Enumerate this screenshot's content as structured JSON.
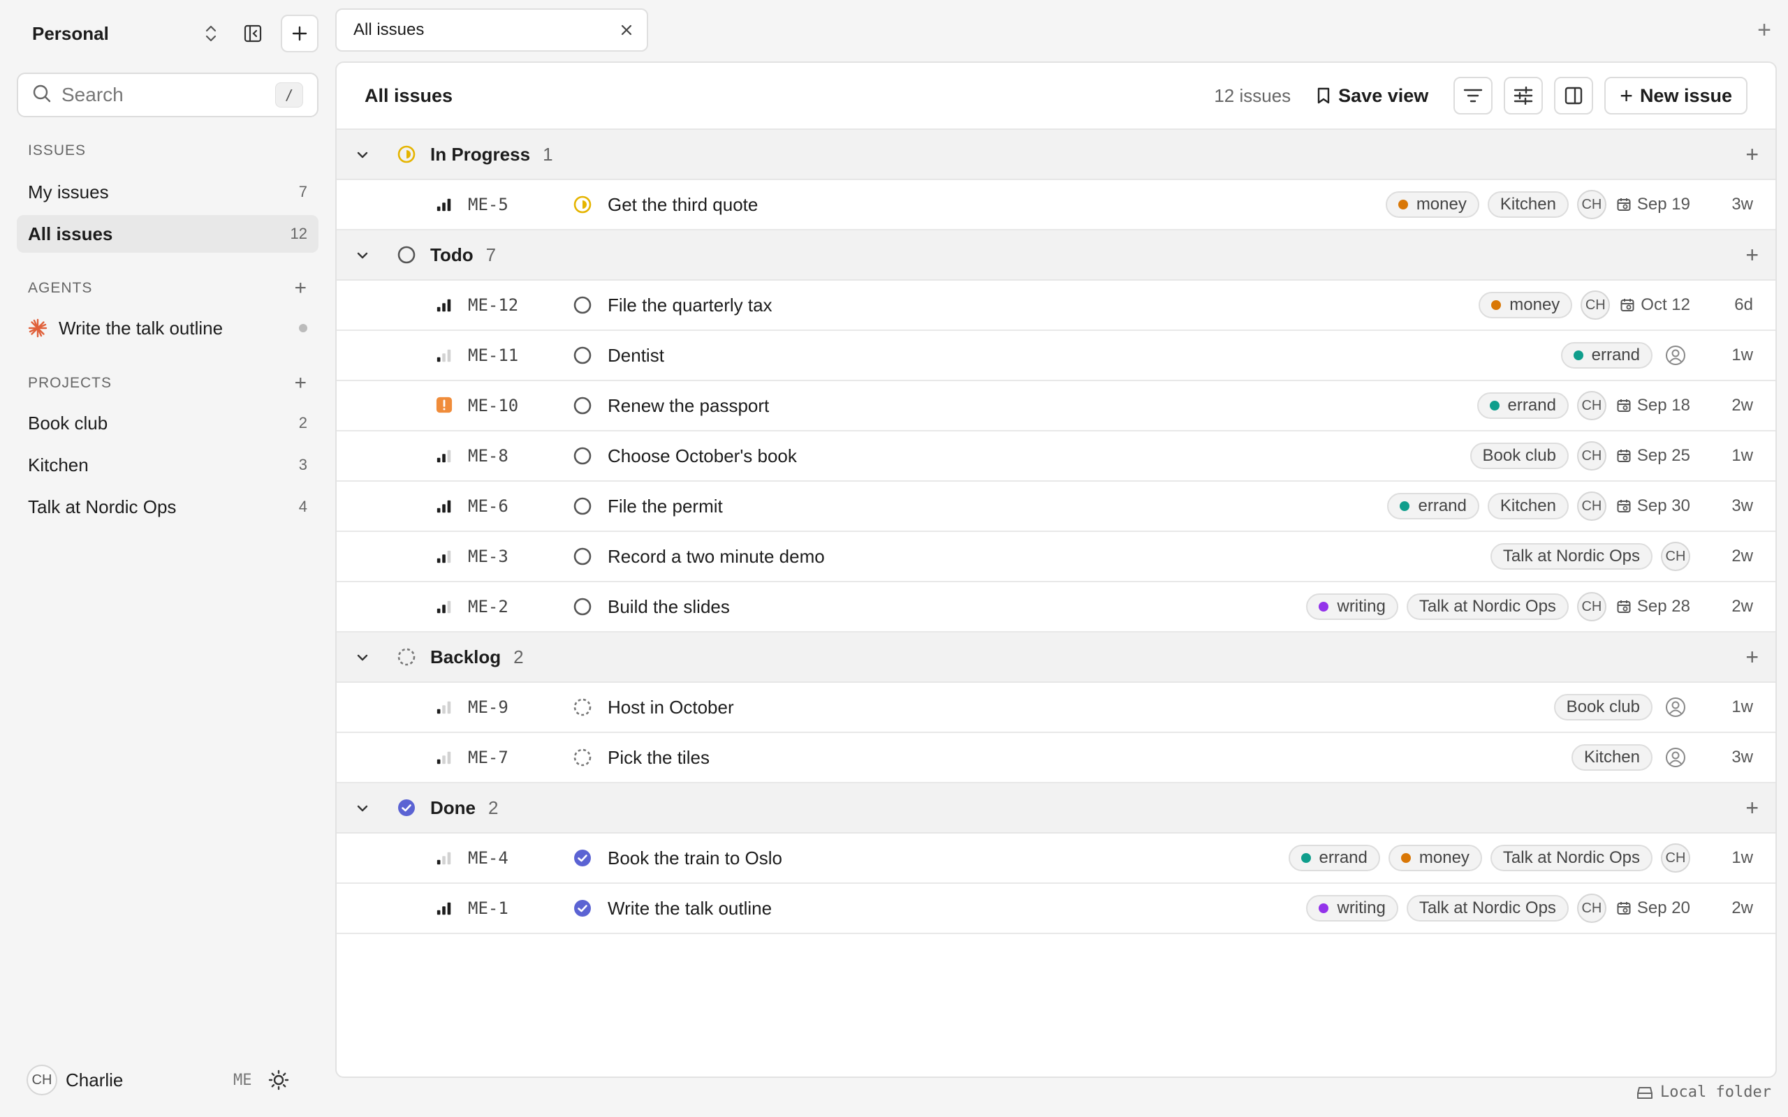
{
  "sidebar": {
    "workspace": "Personal",
    "search": {
      "placeholder": "Search",
      "shortcut": "/"
    },
    "issues_heading": "ISSUES",
    "my_issues": {
      "label": "My issues",
      "count": "7"
    },
    "all_issues": {
      "label": "All issues",
      "count": "12"
    },
    "agents_heading": "AGENTS",
    "agent": {
      "label": "Write the talk outline"
    },
    "projects_heading": "PROJECTS",
    "projects": [
      {
        "label": "Book club",
        "count": "2"
      },
      {
        "label": "Kitchen",
        "count": "3"
      },
      {
        "label": "Talk at Nordic Ops",
        "count": "4"
      }
    ],
    "user": {
      "initials": "CH",
      "name": "Charlie",
      "tag": "ME"
    }
  },
  "tab": {
    "label": "All issues"
  },
  "header": {
    "title": "All issues",
    "count": "12 issues",
    "save_view": "Save view",
    "new_issue": "New issue"
  },
  "footer": {
    "label": "Local folder"
  },
  "colors": {
    "money": "#d97706",
    "errand": "#0f9e8c",
    "writing": "#9333ea",
    "in_progress": "#e5b400",
    "done": "#5b63d3",
    "urgent": "#f08c3a"
  },
  "groups": [
    {
      "name": "In Progress",
      "count": "1",
      "status": "in-progress",
      "rows": [
        {
          "id": "ME-5",
          "title": "Get the third quote",
          "prio": "high",
          "status": "in-progress",
          "chips": [
            {
              "label": "money",
              "dot": "money"
            },
            {
              "label": "Kitchen"
            }
          ],
          "assignee": "CH",
          "due": "Sep 19",
          "age": "3w"
        }
      ]
    },
    {
      "name": "Todo",
      "count": "7",
      "status": "todo",
      "rows": [
        {
          "id": "ME-12",
          "title": "File the quarterly tax",
          "prio": "high",
          "status": "todo",
          "chips": [
            {
              "label": "money",
              "dot": "money"
            }
          ],
          "assignee": "CH",
          "due": "Oct 12",
          "age": "6d"
        },
        {
          "id": "ME-11",
          "title": "Dentist",
          "prio": "low",
          "status": "todo",
          "chips": [
            {
              "label": "errand",
              "dot": "errand"
            }
          ],
          "assignee": "",
          "due": "",
          "age": "1w"
        },
        {
          "id": "ME-10",
          "title": "Renew the passport",
          "prio": "urgent",
          "status": "todo",
          "chips": [
            {
              "label": "errand",
              "dot": "errand"
            }
          ],
          "assignee": "CH",
          "due": "Sep 18",
          "age": "2w"
        },
        {
          "id": "ME-8",
          "title": "Choose October's book",
          "prio": "medium",
          "status": "todo",
          "chips": [
            {
              "label": "Book club"
            }
          ],
          "assignee": "CH",
          "due": "Sep 25",
          "age": "1w"
        },
        {
          "id": "ME-6",
          "title": "File the permit",
          "prio": "high",
          "status": "todo",
          "chips": [
            {
              "label": "errand",
              "dot": "errand"
            },
            {
              "label": "Kitchen"
            }
          ],
          "assignee": "CH",
          "due": "Sep 30",
          "age": "3w"
        },
        {
          "id": "ME-3",
          "title": "Record a two minute demo",
          "prio": "medium",
          "status": "todo",
          "chips": [
            {
              "label": "Talk at Nordic Ops"
            }
          ],
          "assignee": "CH",
          "due": "",
          "age": "2w"
        },
        {
          "id": "ME-2",
          "title": "Build the slides",
          "prio": "medium",
          "status": "todo",
          "chips": [
            {
              "label": "writing",
              "dot": "writing"
            },
            {
              "label": "Talk at Nordic Ops"
            }
          ],
          "assignee": "CH",
          "due": "Sep 28",
          "age": "2w"
        }
      ]
    },
    {
      "name": "Backlog",
      "count": "2",
      "status": "backlog",
      "rows": [
        {
          "id": "ME-9",
          "title": "Host in October",
          "prio": "low",
          "status": "backlog",
          "chips": [
            {
              "label": "Book club"
            }
          ],
          "assignee": "",
          "due": "",
          "age": "1w"
        },
        {
          "id": "ME-7",
          "title": "Pick the tiles",
          "prio": "low",
          "status": "backlog",
          "chips": [
            {
              "label": "Kitchen"
            }
          ],
          "assignee": "",
          "due": "",
          "age": "3w"
        }
      ]
    },
    {
      "name": "Done",
      "count": "2",
      "status": "done",
      "rows": [
        {
          "id": "ME-4",
          "title": "Book the train to Oslo",
          "prio": "low",
          "status": "done",
          "chips": [
            {
              "label": "errand",
              "dot": "errand"
            },
            {
              "label": "money",
              "dot": "money"
            },
            {
              "label": "Talk at Nordic Ops"
            }
          ],
          "assignee": "CH",
          "due": "",
          "age": "1w"
        },
        {
          "id": "ME-1",
          "title": "Write the talk outline",
          "prio": "high",
          "status": "done",
          "chips": [
            {
              "label": "writing",
              "dot": "writing"
            },
            {
              "label": "Talk at Nordic Ops"
            }
          ],
          "assignee": "CH",
          "due": "Sep 20",
          "age": "2w"
        }
      ]
    }
  ]
}
